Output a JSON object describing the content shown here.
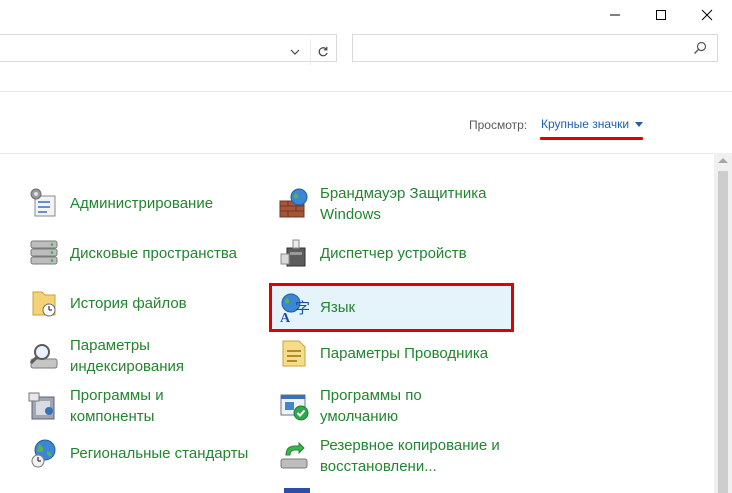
{
  "window": {
    "minimize_glyph": "─",
    "maximize_glyph": "☐",
    "close_glyph": "✕"
  },
  "address": {
    "dropdown_glyph": "⌄",
    "refresh_glyph": "↻"
  },
  "search": {
    "placeholder": ""
  },
  "view": {
    "label": "Просмотр:",
    "value": "Крупные значки"
  },
  "items": [
    {
      "label": "Администрирование",
      "icon": "admin-tools-icon"
    },
    {
      "label": "Брандмауэр Защитника Windows",
      "icon": "firewall-icon"
    },
    {
      "label": "Дисковые пространства",
      "icon": "storage-spaces-icon"
    },
    {
      "label": "Диспетчер устройств",
      "icon": "device-manager-icon"
    },
    {
      "label": "История файлов",
      "icon": "file-history-icon"
    },
    {
      "label": "Язык",
      "icon": "language-icon"
    },
    {
      "label": "Параметры индексирования",
      "icon": "indexing-icon"
    },
    {
      "label": "Параметры Проводника",
      "icon": "explorer-options-icon"
    },
    {
      "label": "Программы и компоненты",
      "icon": "programs-features-icon"
    },
    {
      "label": "Программы по умолчанию",
      "icon": "default-programs-icon"
    },
    {
      "label": "Региональные стандарты",
      "icon": "region-icon"
    },
    {
      "label": "Резервное копирование и восстановлени...",
      "icon": "backup-restore-icon"
    }
  ],
  "colors": {
    "link_green": "#22852f",
    "view_blue": "#1e5fad",
    "highlight_red": "#e00000",
    "selected_bg": "#e5f3fb"
  }
}
